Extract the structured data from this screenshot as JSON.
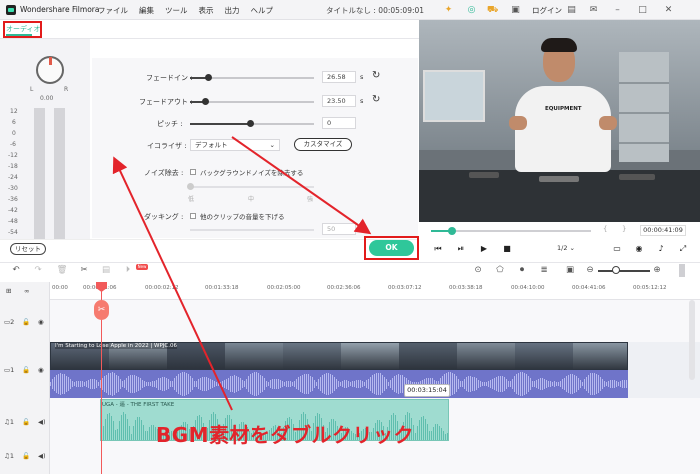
{
  "titlebar": {
    "app_name": "Wondershare Filmora",
    "menus": [
      "ファイル",
      "編集",
      "ツール",
      "表示",
      "出力",
      "ヘルプ"
    ],
    "doc_title": "タイトルなし : 00:05:09:01",
    "login": "ログイン"
  },
  "audio_panel": {
    "tab": "オーディオ",
    "pan_value": "0.00",
    "pan_left": "L",
    "pan_right": "R",
    "meter_ticks": [
      "12",
      "6",
      "0",
      "-6",
      "-12",
      "-18",
      "-24",
      "-30",
      "-36",
      "-42",
      "-48",
      "-54"
    ],
    "fade_in_label": "フェードイン :",
    "fade_in_value": "26.58",
    "fade_out_label": "フェードアウト :",
    "fade_out_value": "23.50",
    "unit": "s",
    "pitch_label": "ピッチ :",
    "pitch_value": "0",
    "eq_label": "イコライザ :",
    "eq_value": "デフォルト",
    "customize_label": "カスタマイズ",
    "denoise_label": "ノイズ除去 :",
    "denoise_option": "バックグラウンドノイズを除去する",
    "denoise_marks": [
      "低",
      "中",
      "強"
    ],
    "ducking_label": "ダッキング :",
    "ducking_option": "他のクリップの音量を下げる",
    "ducking_value": "50",
    "reset_label": "リセット",
    "ok_label": "OK"
  },
  "preview": {
    "shirt_text": "EQUIPMENT",
    "time_current": "00:00:41:09",
    "bracket_left": "{",
    "bracket_right": "}",
    "speed": "1/2",
    "progress": 0.13
  },
  "timeline": {
    "ruler_labels": [
      "00:00",
      "00:00:01:06",
      "00:00:02:12",
      "00:01:33:18",
      "00:02:05:00",
      "00:02:36:06",
      "00:03:07:12",
      "00:03:38:18",
      "00:04:10:00",
      "00:04:41:06",
      "00:05:12:12"
    ],
    "video_clip_name": "I'm Starting to Lose Apple in 2022 | WPJC.06",
    "bgm_clip_name": "UGA - 遥 - THE FIRST TAKE",
    "tooltip_time": "00:03:15:04",
    "zoom_level": 0.35,
    "new_badge": "New",
    "track_labels": [
      "2",
      "1",
      "1",
      "1"
    ]
  },
  "annotation": {
    "caption": "BGM素材をダブルクリック",
    "accent_color": "#e3242b"
  }
}
